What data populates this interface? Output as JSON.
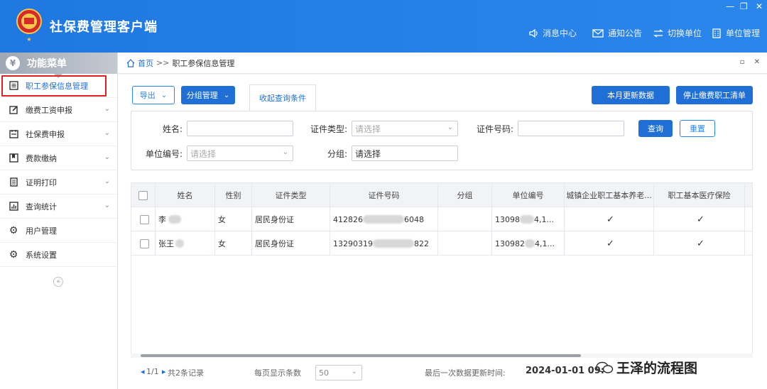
{
  "app": {
    "title": "社保费管理客户端"
  },
  "header_nav": [
    {
      "label": "消息中心",
      "icon": "speaker-icon"
    },
    {
      "label": "通知公告",
      "icon": "mail-icon"
    },
    {
      "label": "切换单位",
      "icon": "switch-icon"
    },
    {
      "label": "单位管理",
      "icon": "building-icon"
    }
  ],
  "sidebar": {
    "title": "功能菜单",
    "items": [
      {
        "label": "职工参保信息管理",
        "icon": "list-icon",
        "active": true
      },
      {
        "label": "缴费工资申报",
        "icon": "edit-icon"
      },
      {
        "label": "社保费申报",
        "icon": "calendar-icon"
      },
      {
        "label": "费款缴纳",
        "icon": "book-icon"
      },
      {
        "label": "证明打印",
        "icon": "document-icon"
      },
      {
        "label": "查询统计",
        "icon": "chart-icon"
      },
      {
        "label": "用户管理",
        "icon": "gear-icon"
      },
      {
        "label": "系统设置",
        "icon": "gear-icon"
      }
    ],
    "collapse_symbol": "«"
  },
  "breadcrumb": {
    "home": "首页",
    "separator": ">>",
    "current": "职工参保信息管理"
  },
  "toolbar": {
    "export": "导出",
    "group_manage": "分组管理",
    "tab_collapse": "收起查询条件",
    "update_month": "本月更新数据",
    "stop_list": "停止缴费职工清单"
  },
  "filters": {
    "name_label": "姓名:",
    "id_type_label": "证件类型:",
    "id_type_placeholder": "请选择",
    "id_no_label": "证件号码:",
    "unit_no_label": "单位编号:",
    "unit_no_placeholder": "请选择",
    "group_label": "分组:",
    "group_value": "请选择",
    "query": "查询",
    "reset": "重置"
  },
  "table": {
    "headers": [
      "姓名",
      "性别",
      "证件类型",
      "证件号码",
      "分组",
      "单位编号",
      "城镇企业职工基本养老...",
      "职工基本医疗保险"
    ],
    "rows": [
      {
        "name": "李",
        "gender": "女",
        "id_type": "居民身份证",
        "id_prefix": "412826",
        "id_suffix": "6048",
        "group": "",
        "unit_prefix": "13098",
        "unit_suffix": "4,1...",
        "pension": "✓",
        "medical": "✓"
      },
      {
        "name": "张王",
        "gender": "女",
        "id_type": "居民身份证",
        "id_prefix": "13290319",
        "id_suffix": "822",
        "group": "",
        "unit_prefix": "130982",
        "unit_suffix": "4,1...",
        "pension": "✓",
        "medical": "✓"
      }
    ]
  },
  "pager": {
    "page": "1/1",
    "total": "共2条记录",
    "page_size_label": "每页显示条数",
    "page_size": "50",
    "last_update_label": "最后一次数据更新时间:",
    "last_update_value": "2024-01-01 09:"
  },
  "watermark": {
    "text": "王泽的流程图"
  },
  "colors": {
    "header": "#2b86ec",
    "primary": "#1f6fd6",
    "highlight": "#e02020"
  }
}
